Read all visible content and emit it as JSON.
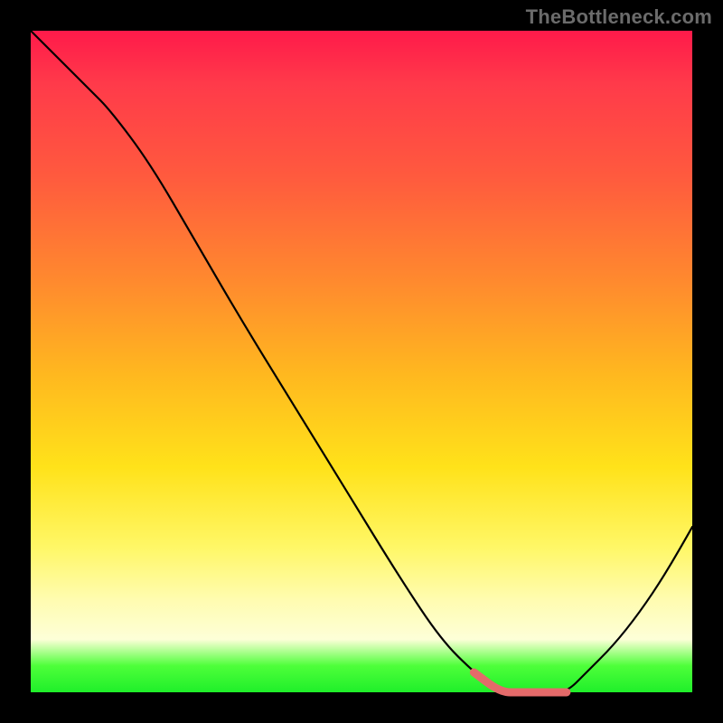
{
  "watermark": "TheBottleneck.com",
  "chart_data": {
    "type": "line",
    "title": "",
    "xlabel": "",
    "ylabel": "",
    "xlim": [
      0,
      1
    ],
    "ylim": [
      0,
      1
    ],
    "series": [
      {
        "name": "curve",
        "x": [
          0.0,
          0.03,
          0.06,
          0.09,
          0.12,
          0.18,
          0.25,
          0.32,
          0.4,
          0.48,
          0.56,
          0.62,
          0.67,
          0.71,
          0.74,
          0.78,
          0.81,
          0.84,
          0.88,
          0.92,
          0.96,
          1.0
        ],
        "values": [
          1.0,
          0.97,
          0.94,
          0.91,
          0.88,
          0.8,
          0.68,
          0.56,
          0.43,
          0.3,
          0.17,
          0.08,
          0.03,
          0.0,
          0.0,
          0.0,
          0.0,
          0.03,
          0.07,
          0.12,
          0.18,
          0.25
        ]
      }
    ],
    "highlight": {
      "name": "bottleneck-range",
      "x_start": 0.67,
      "x_end": 0.81,
      "color": "#e46a6a"
    }
  }
}
